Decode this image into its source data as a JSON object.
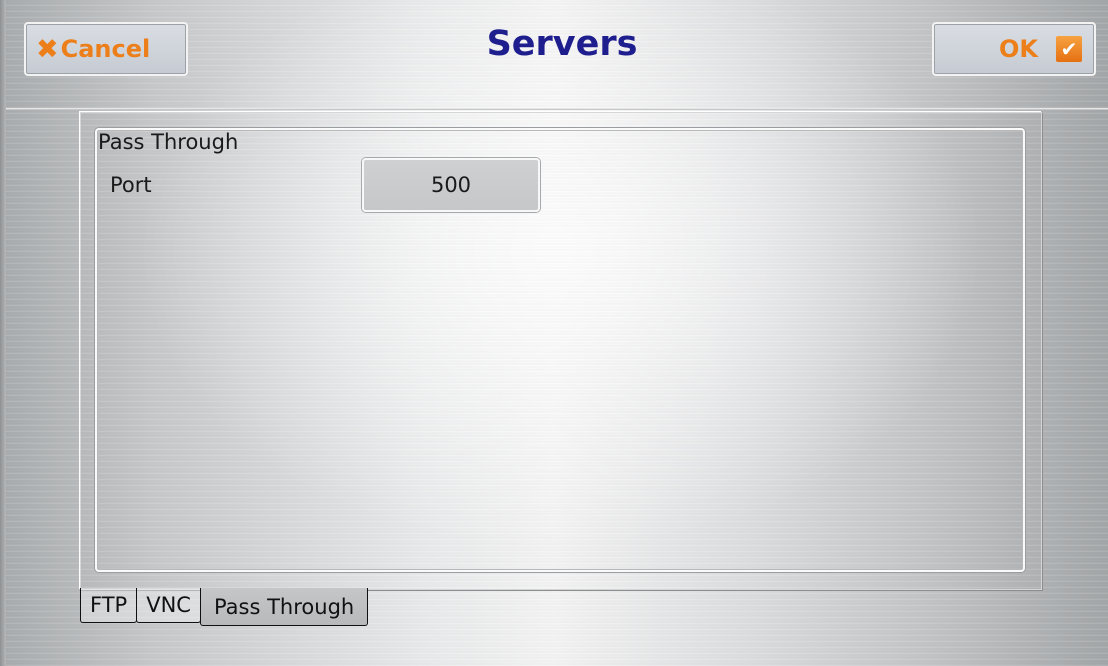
{
  "header": {
    "title": "Servers",
    "cancel_label": "Cancel",
    "ok_label": "OK"
  },
  "icons": {
    "cancel": "close-x-icon",
    "ok": "checkbox-checked-icon"
  },
  "colors": {
    "accent": "#ec7f19",
    "title": "#1e1e8e"
  },
  "group": {
    "title": "Pass Through",
    "port_label": "Port",
    "port_value": "500"
  },
  "tabs": [
    {
      "label": "FTP",
      "active": false
    },
    {
      "label": "VNC",
      "active": false
    },
    {
      "label": "Pass Through",
      "active": true
    }
  ]
}
